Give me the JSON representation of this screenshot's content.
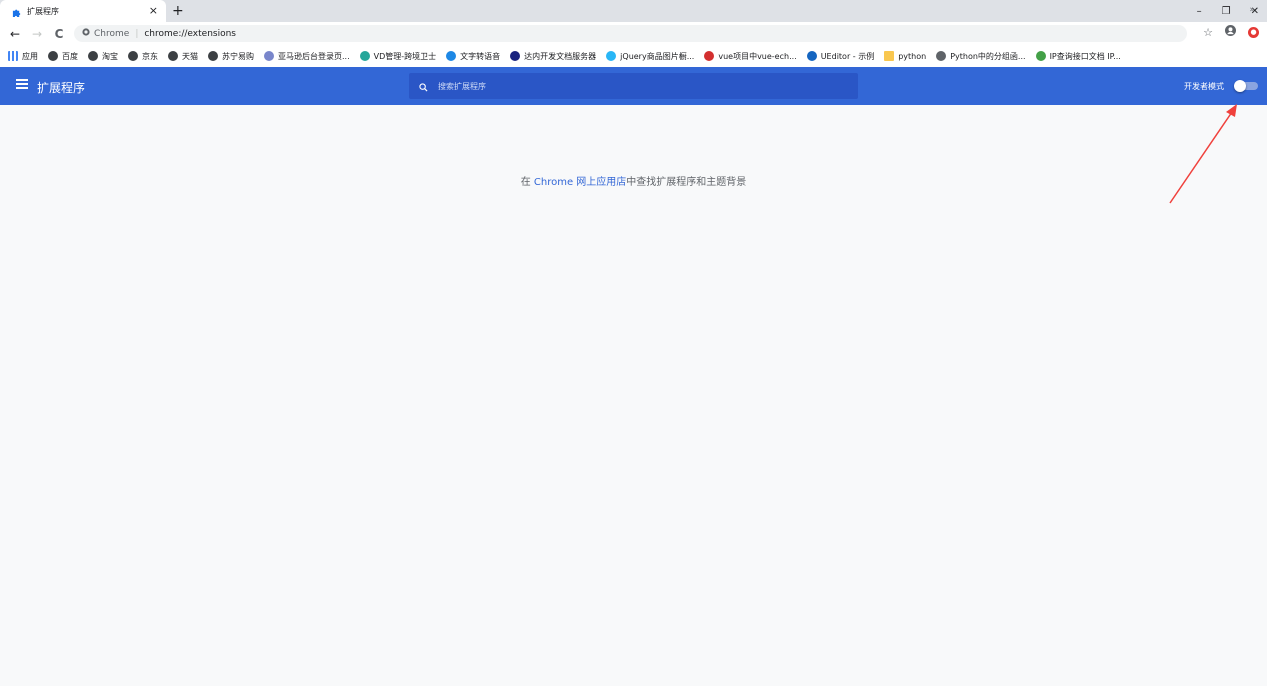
{
  "tab": {
    "title": "扩展程序",
    "icon": "puzzle-icon",
    "close": "×",
    "new": "+"
  },
  "window": {
    "minimize": "–",
    "restore": "❐",
    "close": "✕"
  },
  "toolbar": {
    "back": "←",
    "forward": "→",
    "reload": "C",
    "site_label": "Chrome",
    "separator": "|",
    "url": "chrome://extensions",
    "bookmark_star": "☆",
    "more": "»"
  },
  "bookmarks": [
    {
      "label": "应用",
      "icon": "apps-grid-icon",
      "color": "#4285f4"
    },
    {
      "label": "百度",
      "icon": "globe-icon",
      "color": "#3c4043"
    },
    {
      "label": "淘宝",
      "icon": "globe-icon",
      "color": "#3c4043"
    },
    {
      "label": "京东",
      "icon": "globe-icon",
      "color": "#3c4043"
    },
    {
      "label": "天猫",
      "icon": "globe-icon",
      "color": "#3c4043"
    },
    {
      "label": "苏宁易购",
      "icon": "globe-icon",
      "color": "#3c4043"
    },
    {
      "label": "亚马逊后台登录页...",
      "icon": "globe-icon",
      "color": "#7986cb"
    },
    {
      "label": "VD管理-跨境卫士",
      "icon": "shield-icon",
      "color": "#26a69a"
    },
    {
      "label": "文字转语音",
      "icon": "voice-icon",
      "color": "#1e88e5"
    },
    {
      "label": "达内开发文档服务器",
      "icon": "tarena-icon",
      "color": "#1a237e"
    },
    {
      "label": "jQuery商品图片橱...",
      "icon": "jquery-icon",
      "color": "#29b6f6"
    },
    {
      "label": "vue项目中vue-ech...",
      "icon": "csdn-icon",
      "color": "#d32f2f"
    },
    {
      "label": "UEditor - 示例",
      "icon": "ueditor-icon",
      "color": "#1565c0"
    },
    {
      "label": "python",
      "icon": "folder-icon",
      "color": "#f9c74f"
    },
    {
      "label": "Python中的分组函...",
      "icon": "python-icon",
      "color": "#5f6368"
    },
    {
      "label": "IP查询接口文档 IP...",
      "icon": "map-icon",
      "color": "#43a047"
    }
  ],
  "bookmarks_more": "»",
  "header": {
    "title": "扩展程序",
    "search_placeholder": "搜索扩展程序",
    "dev_mode_label": "开发者模式",
    "dev_mode_on": false
  },
  "main": {
    "prefix": "在 ",
    "link_text": "Chrome 网上应用店",
    "suffix": "中查找扩展程序和主题背景"
  }
}
